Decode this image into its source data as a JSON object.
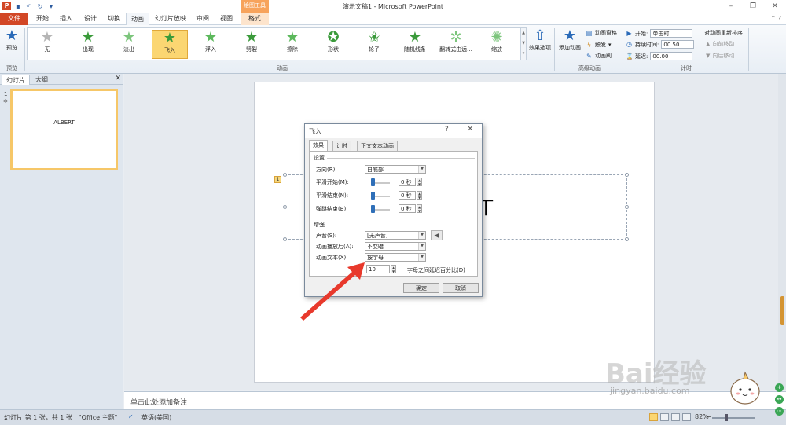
{
  "app": {
    "title": "演示文稿1 - Microsoft PowerPoint",
    "contextual_tab_group": "绘图工具",
    "icon_letter": "P"
  },
  "tabs": [
    {
      "label": "文件"
    },
    {
      "label": "开始"
    },
    {
      "label": "插入"
    },
    {
      "label": "设计"
    },
    {
      "label": "切换"
    },
    {
      "label": "动画"
    },
    {
      "label": "幻灯片放映"
    },
    {
      "label": "审阅"
    },
    {
      "label": "视图"
    },
    {
      "label": "格式"
    }
  ],
  "ribbon": {
    "preview": {
      "label": "预览",
      "group": "预览"
    },
    "animations": [
      {
        "label": "无"
      },
      {
        "label": "出现"
      },
      {
        "label": "淡出"
      },
      {
        "label": "飞入"
      },
      {
        "label": "浮入"
      },
      {
        "label": "劈裂"
      },
      {
        "label": "擦除"
      },
      {
        "label": "形状"
      },
      {
        "label": "轮子"
      },
      {
        "label": "随机线条"
      },
      {
        "label": "翻转式由远..."
      },
      {
        "label": "缩放"
      }
    ],
    "animation_group": "动画",
    "effect_options": "效果选项",
    "add_animation": "添加动画",
    "animation_pane": "动画窗格",
    "trigger": "触发",
    "animation_painter": "动画刷",
    "advanced_group": "高级动画",
    "start_label": "开始:",
    "start_value": "单击时",
    "duration_label": "持续时间:",
    "duration_value": "00.50",
    "delay_label": "延迟:",
    "delay_value": "00.00",
    "reorder_label": "对动画重新排序",
    "move_earlier": "向前移动",
    "move_later": "向后移动",
    "timing_group": "计时"
  },
  "left_pane": {
    "tab_slides": "幻灯片",
    "tab_outline": "大纲",
    "slide_number": "1",
    "slide_text": "ALBERT"
  },
  "slide": {
    "visible_letter": "T"
  },
  "notes": {
    "placeholder": "单击此处添加备注"
  },
  "status": {
    "slide_info": "幻灯片 第 1 张，共 1 张",
    "theme": "\"Office 主题\"",
    "language": "英语(美国)",
    "zoom": "82%"
  },
  "dialog": {
    "title": "飞入",
    "help": "?",
    "tabs": [
      {
        "label": "效果"
      },
      {
        "label": "计时"
      },
      {
        "label": "正文文本动画"
      }
    ],
    "settings_section": "设置",
    "direction_label": "方向(R):",
    "direction_value": "自底部",
    "smooth_start_label": "平滑开始(M):",
    "smooth_start_value": "0 秒",
    "smooth_end_label": "平滑结束(N):",
    "smooth_end_value": "0 秒",
    "bounce_end_label": "弹跳结束(B):",
    "bounce_end_value": "0 秒",
    "enhance_section": "增强",
    "sound_label": "声音(S):",
    "sound_value": "[无声音]",
    "after_label": "动画播放后(A):",
    "after_value": "不变暗",
    "text_label": "动画文本(X):",
    "text_value": "按字母",
    "delay_percent_value": "10",
    "delay_percent_label": "字母之间延迟百分比(D)",
    "ok": "确定",
    "cancel": "取消"
  },
  "watermark": {
    "brand": "Bai经验",
    "url": "jingyan.baidu.com"
  },
  "colors": {
    "file_tab": "#d24726",
    "selected_anim": "#fbd672",
    "arrow": "#e8392c",
    "accent": "#2f6fb8"
  }
}
